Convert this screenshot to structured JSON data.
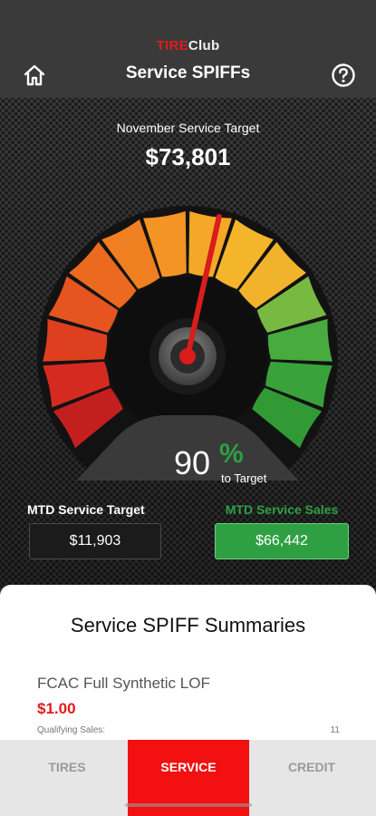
{
  "header": {
    "brand_red": "TIRE",
    "brand_white": "Club",
    "title": "Service SPIFFs",
    "home_icon": "home-icon",
    "help_icon": "question-circle-icon"
  },
  "dashboard": {
    "target_label": "November Service Target",
    "target_value": "$73,801",
    "percent_value": "90",
    "percent_symbol": "%",
    "percent_caption": "to Target",
    "gauge_level": 0.9,
    "mtd_target_label": "MTD Service Target",
    "mtd_target_value": "$11,903",
    "mtd_sales_label": "MTD Service Sales",
    "mtd_sales_value": "$66,442"
  },
  "summary": {
    "title": "Service SPIFF Summaries",
    "items": [
      {
        "name": "FCAC Full Synthetic LOF",
        "amount": "$1.00",
        "qualifying_label": "Qualifying Sales:",
        "qualifying_value": "11"
      }
    ]
  },
  "tabs": [
    {
      "label": "TIRES",
      "active": false
    },
    {
      "label": "SERVICE",
      "active": true
    },
    {
      "label": "CREDIT",
      "active": false
    }
  ],
  "colors": {
    "accent_red": "#f21010",
    "success_green": "#2ea043",
    "header_bg": "#3a3a3a"
  }
}
